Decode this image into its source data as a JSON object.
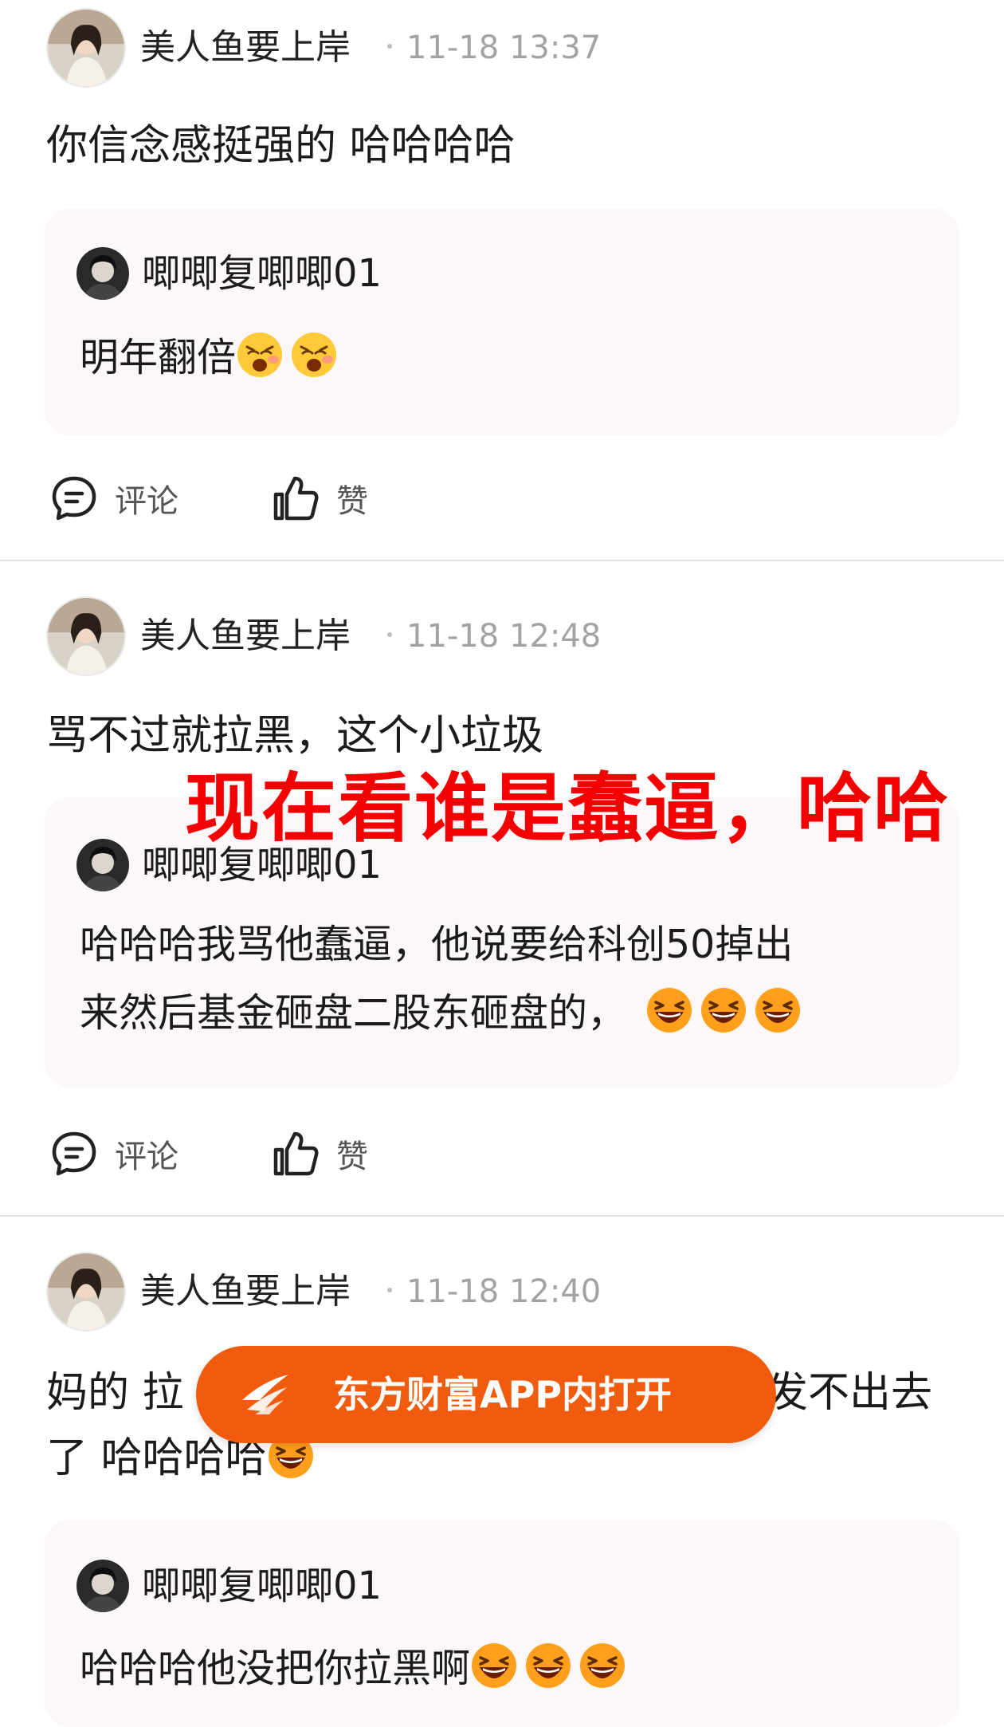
{
  "comments": [
    {
      "username": "美人鱼要上岸",
      "time": "11-18 13:37",
      "text": "你信念感挺强的 哈哈哈哈",
      "reply": {
        "username": "唧唧复唧唧01",
        "text_line1": "明年翻倍",
        "emojis": [
          "yawn-emoji",
          "yawn-emoji"
        ]
      },
      "actions": {
        "comment_label": "评论",
        "like_label": "赞"
      }
    },
    {
      "username": "美人鱼要上岸",
      "time": "11-18 12:48",
      "text": "骂不过就拉黑，这个小垃圾",
      "reply": {
        "username": "唧唧复唧唧01",
        "text_line1": "哈哈哈我骂他蠢逼，他说要给科创50掉出",
        "text_line2": "来然后基金砸盘二股东砸盘的，",
        "emojis": [
          "laugh-emoji",
          "laugh-emoji",
          "laugh-emoji"
        ]
      },
      "actions": {
        "comment_label": "评论",
        "like_label": "赞"
      }
    },
    {
      "username": "美人鱼要上岸",
      "time": "11-18 12:40",
      "text_line1_left": "妈的 拉",
      "text_line1_right": "发不出去",
      "text_line2": "了 哈哈哈哈",
      "emojis": [
        "laugh-emoji"
      ],
      "reply": {
        "username": "唧唧复唧唧01",
        "text_line1": "哈哈哈他没把你拉黑啊",
        "emojis": [
          "laugh-emoji",
          "laugh-emoji",
          "laugh-emoji"
        ]
      }
    }
  ],
  "overlay_text": "现在看谁是蠢逼，哈哈",
  "open_app_button": {
    "label": "东方财富APP内打开",
    "icon": "eastmoney-logo-icon"
  },
  "colors": {
    "accent": "#f15b0d",
    "overlay": "#f40000",
    "reply_bg": "#fcf8fa"
  }
}
